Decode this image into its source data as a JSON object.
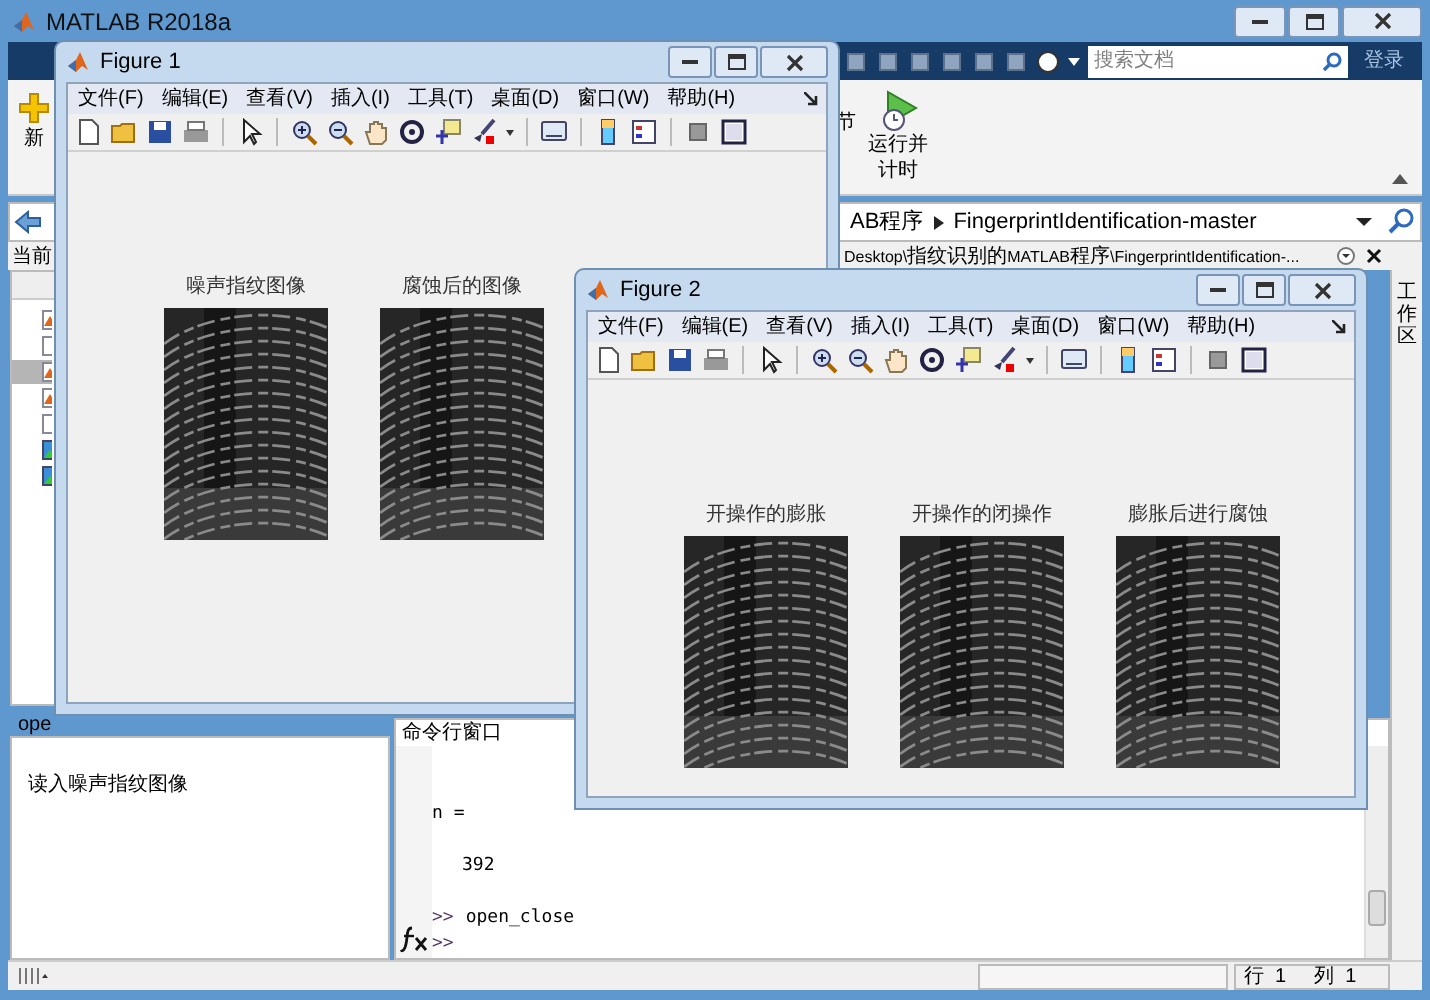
{
  "window": {
    "title": "MATLAB R2018a"
  },
  "search": {
    "placeholder": "搜索文档"
  },
  "login": "登录",
  "toolstrip": [
    {
      "kind": "new",
      "label": "新"
    },
    {
      "kind": "section",
      "label": "节"
    },
    {
      "kind": "run_time",
      "label": "运行并计时"
    }
  ],
  "address": {
    "crumbs": [
      "AB程序",
      "FingerprintIdentification-master"
    ]
  },
  "current_folder": {
    "label": "当前",
    "path": "Desktop\\指纹识别的MATLAB程序\\FingerprintIdentification-..."
  },
  "files": [
    {
      "kind": "mfile",
      "selected": false
    },
    {
      "kind": "file",
      "selected": false
    },
    {
      "kind": "mfile",
      "selected": true
    },
    {
      "kind": "mfile",
      "selected": false
    },
    {
      "kind": "file",
      "selected": false
    },
    {
      "kind": "image",
      "selected": false
    },
    {
      "kind": "image",
      "selected": false
    }
  ],
  "details": {
    "header": "ope",
    "text": "读入噪声指纹图像"
  },
  "command_window": {
    "title": "命令行窗口",
    "lines": [
      {
        "kind": "output",
        "text": "n ="
      },
      {
        "kind": "value",
        "text": "392"
      },
      {
        "kind": "command",
        "prompt": ">>",
        "text": "open_close"
      }
    ],
    "prompt": ">>"
  },
  "workspace_tab": "工作区",
  "status_bar": {
    "row": "行  1",
    "col": "列  1"
  },
  "figures": [
    {
      "title": "Figure 1",
      "menus": [
        "文件(F)",
        "编辑(E)",
        "查看(V)",
        "插入(I)",
        "工具(T)",
        "桌面(D)",
        "窗口(W)",
        "帮助(H)"
      ],
      "plots": [
        "噪声指纹图像",
        "腐蚀后的图像"
      ]
    },
    {
      "title": "Figure 2",
      "menus": [
        "文件(F)",
        "编辑(E)",
        "查看(V)",
        "插入(I)",
        "工具(T)",
        "桌面(D)",
        "窗口(W)",
        "帮助(H)"
      ],
      "plots": [
        "开操作的膨胀",
        "开操作的闭操作",
        "膨胀后进行腐蚀"
      ]
    }
  ]
}
